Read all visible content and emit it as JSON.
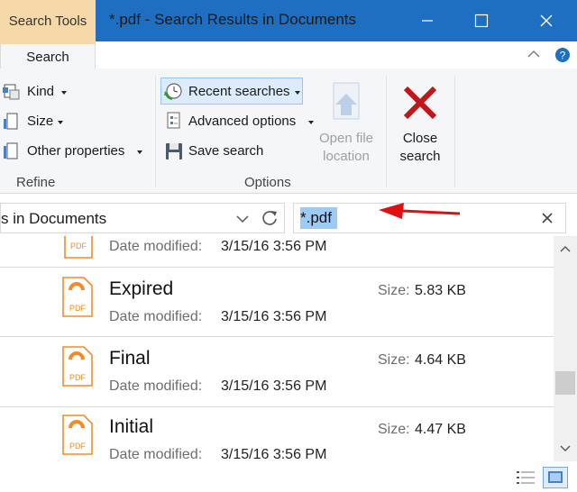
{
  "window": {
    "contextual_tab": "Search Tools",
    "title": "*.pdf - Search Results in Documents",
    "controls": [
      "minimize-icon",
      "maximize-icon",
      "close-icon"
    ]
  },
  "ribbon": {
    "active_tab": "Search",
    "refine": {
      "label": "Refine",
      "items": [
        {
          "label": "Kind",
          "icon": "kind-icon"
        },
        {
          "label": "Size",
          "icon": "size-icon"
        },
        {
          "label": "Other properties",
          "icon": "properties-icon"
        }
      ]
    },
    "options": {
      "label": "Options",
      "recent_searches": "Recent searches",
      "advanced_options": "Advanced options",
      "save_search": "Save search",
      "open_file_location": "Open file location",
      "open_file_location_lines": [
        "Open file",
        "location"
      ]
    },
    "close_search_lines": [
      "Close",
      "search"
    ]
  },
  "address": {
    "path_text": "s in Documents",
    "search_value": "*.pdf"
  },
  "results": {
    "top_partial": {
      "date_label": "Date modified:",
      "date": "3/15/16 3:56 PM"
    },
    "items": [
      {
        "name": "Expired",
        "date_label": "Date modified:",
        "date": "3/15/16 3:56 PM",
        "size_label": "Size:",
        "size": "5.83 KB",
        "icon": "pdf-file-icon"
      },
      {
        "name": "Final",
        "date_label": "Date modified:",
        "date": "3/15/16 3:56 PM",
        "size_label": "Size:",
        "size": "4.64 KB",
        "icon": "pdf-file-icon"
      },
      {
        "name": "Initial",
        "date_label": "Date modified:",
        "date": "3/15/16 3:56 PM",
        "size_label": "Size:",
        "size": "4.47 KB",
        "icon": "pdf-file-icon"
      }
    ],
    "icon_text": "PDF"
  },
  "colors": {
    "titlebar": "#1e6fc2",
    "contextual_tab": "#f7d8a8",
    "annotation_arrow": "#e01010",
    "pdf_accent": "#f28c28"
  }
}
